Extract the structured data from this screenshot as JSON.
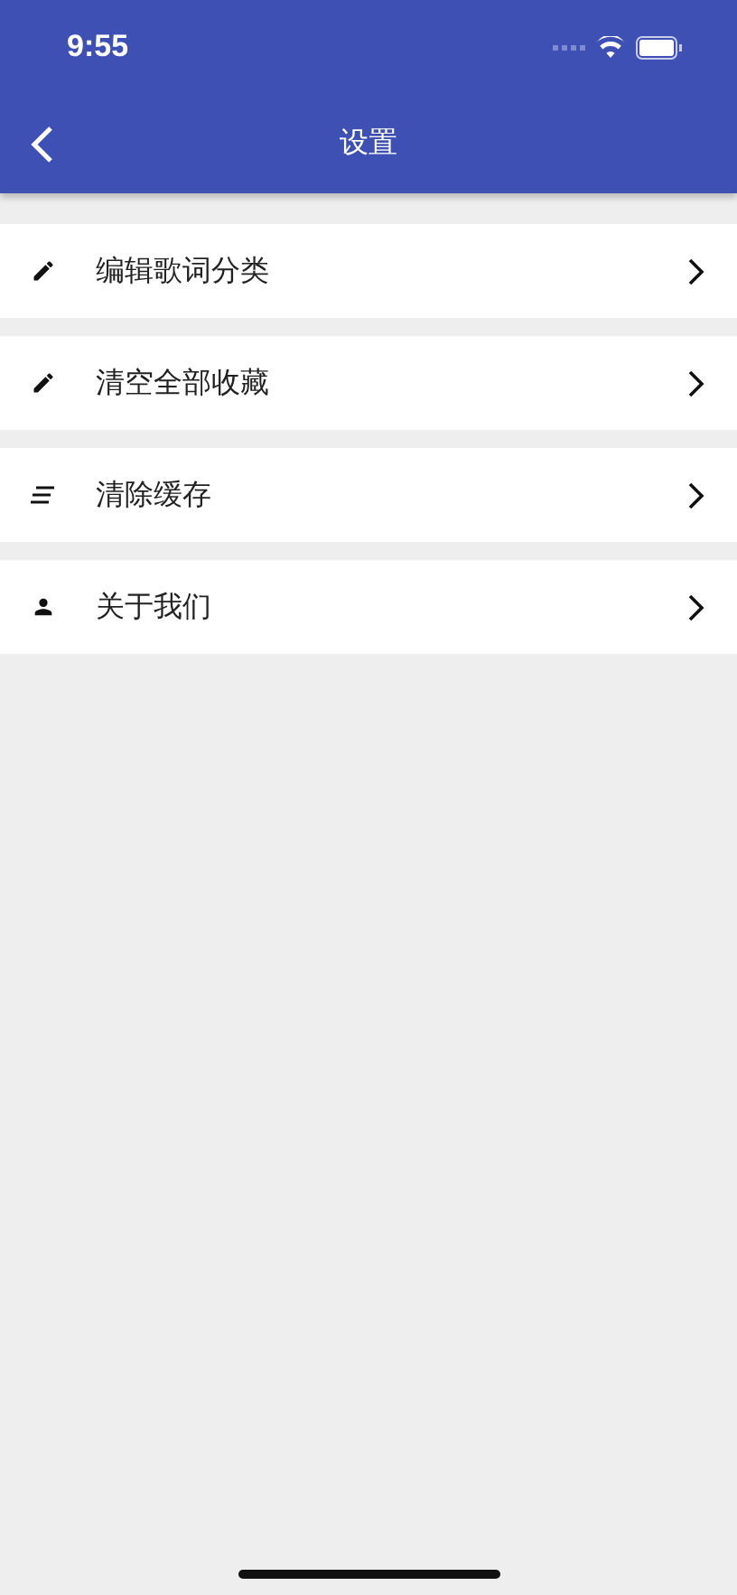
{
  "status_bar": {
    "time": "9:55"
  },
  "nav_bar": {
    "title": "设置"
  },
  "settings": [
    {
      "kind": "edit",
      "label": "编辑歌词分类"
    },
    {
      "kind": "edit",
      "label": "清空全部收藏"
    },
    {
      "kind": "clear",
      "label": "清除缓存"
    },
    {
      "kind": "person",
      "label": "关于我们"
    }
  ]
}
